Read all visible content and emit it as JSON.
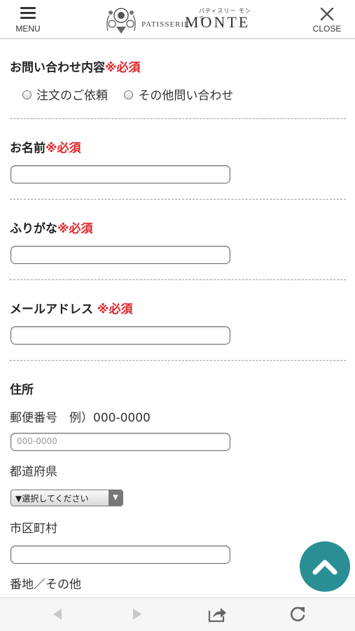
{
  "header": {
    "menu_label": "MENU",
    "close_label": "CLOSE",
    "logo_kana": "パティスリー モンテ",
    "logo_patisserie": "PATISSERIE",
    "logo_brand": "MONTE"
  },
  "form": {
    "inquiry": {
      "label": "お問い合わせ内容",
      "required": "※必須",
      "options": [
        "注文のご依頼",
        "その他問い合わせ"
      ]
    },
    "name": {
      "label": "お名前",
      "required": "※必須",
      "value": ""
    },
    "furigana": {
      "label": "ふりがな",
      "required": "※必須",
      "value": ""
    },
    "email": {
      "label": "メールアドレス",
      "required": " ※必須",
      "value": ""
    },
    "address": {
      "label": "住所",
      "postal_label": "郵便番号　例）000-0000",
      "postal_placeholder": "000-0000",
      "prefecture_label": "都道府県",
      "prefecture_select": "▼選択してください",
      "city_label": "市区町村",
      "street_label": "番地／その他"
    }
  },
  "theme": {
    "accent": "#2a8f95",
    "required_color": "#e0262b"
  },
  "icons": {
    "scroll_top": "chevron-up-icon",
    "back": "arrow-left-icon",
    "forward": "arrow-right-icon",
    "share": "share-icon",
    "reload": "reload-icon"
  }
}
